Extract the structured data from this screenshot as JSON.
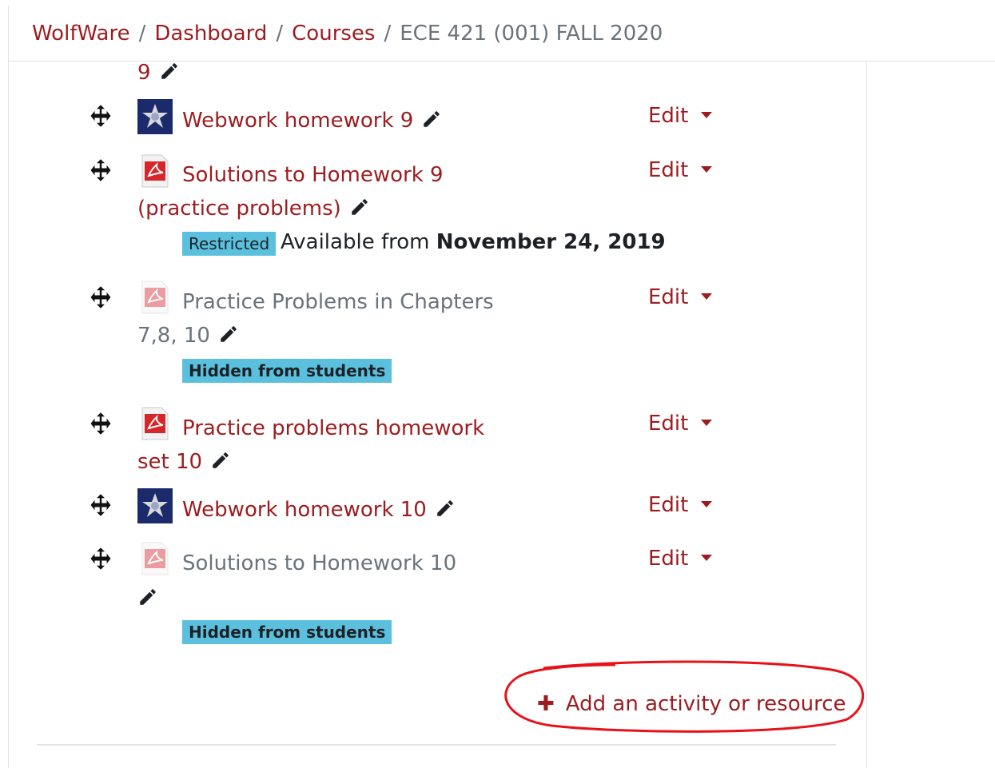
{
  "breadcrumb": {
    "items": [
      "WolfWare",
      "Dashboard",
      "Courses"
    ],
    "current": "ECE 421 (001) FALL 2020",
    "separator": "/"
  },
  "activities": [
    {
      "name_line1": "9",
      "partial": true
    },
    {
      "name": "Webwork homework 9",
      "type": "webwork",
      "edit_label": "Edit"
    },
    {
      "name_line1": "Solutions to Homework 9",
      "name_line2": "(practice problems)",
      "type": "pdf",
      "edit_label": "Edit",
      "badge": "Restricted",
      "availability_prefix": "Available from",
      "availability_date": "November 24, 2019"
    },
    {
      "name_line1": "Practice Problems in Chapters",
      "name_line2": "7,8, 10",
      "type": "pdf",
      "hidden": true,
      "edit_label": "Edit",
      "badge": "Hidden from students"
    },
    {
      "name_line1": "Practice problems homework",
      "name_line2": "set 10",
      "type": "pdf",
      "edit_label": "Edit"
    },
    {
      "name": "Webwork homework 10",
      "type": "webwork",
      "edit_label": "Edit"
    },
    {
      "name": "Solutions to Homework 10",
      "type": "pdf",
      "hidden": true,
      "edit_label": "Edit",
      "badge": "Hidden from students"
    }
  ],
  "add_activity": {
    "icon": "plus-icon",
    "label": "Add an activity or resource"
  },
  "colors": {
    "link": "#9d1c1f",
    "muted": "#6a737b",
    "badge": "#5bc0de",
    "annotation": "#e8111a"
  }
}
